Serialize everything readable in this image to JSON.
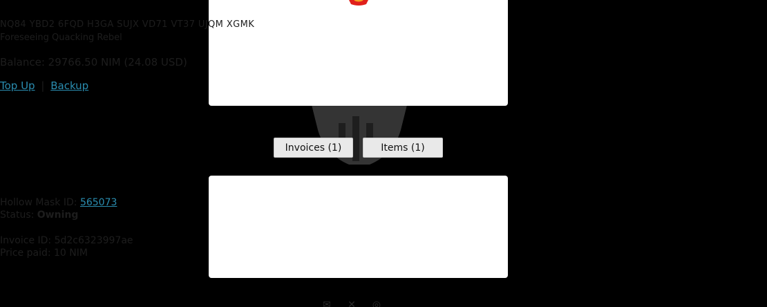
{
  "wallet": {
    "address": "NQ84 YBD2 6FQD H3GA SUJX VD71 VT37 UJQM XGMK",
    "name": "Foreseeing Quacking Rebel",
    "balance_label": "Balance:",
    "balance_value": "29766.50 NIM (24.08 USD)",
    "top_up_label": "Top Up",
    "separator": "|",
    "backup_label": "Backup"
  },
  "tabs": {
    "invoices_label": "Invoices (1)",
    "items_label": "Items (1)"
  },
  "item": {
    "mask_id_label": "Hollow Mask ID:",
    "mask_id_value": "565073",
    "status_label": "Status:",
    "status_value": "Owning",
    "invoice_id_label": "Invoice ID:",
    "invoice_id_value": "5d2c6323997ae",
    "price_label": "Price paid:",
    "price_value": "10 NIM"
  },
  "colors": {
    "background": "#000000",
    "card": "#ffffff",
    "link": "#2a8db0",
    "logo_red": "#e0201b",
    "button_bg": "#e9e9e9"
  },
  "icons": {
    "footer": [
      "mail-icon",
      "x-icon",
      "github-icon"
    ],
    "background": "hollow-mask-icon"
  }
}
